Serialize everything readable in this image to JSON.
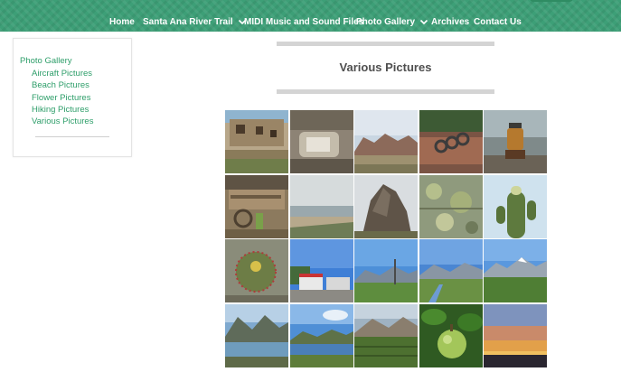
{
  "nav": {
    "items": [
      {
        "label": "Home",
        "dropdown": false
      },
      {
        "label": "Santa Ana River Trail",
        "dropdown": true
      },
      {
        "label": "MIDI Music and Sound Files",
        "dropdown": false
      },
      {
        "label": "Photo Gallery",
        "dropdown": true
      },
      {
        "label": "Archives",
        "dropdown": false
      },
      {
        "label": "Contact Us",
        "dropdown": false
      }
    ]
  },
  "sidebar": {
    "heading": "Photo Gallery",
    "links": [
      "Aircraft Pictures",
      "Beach Pictures",
      "Flower Pictures",
      "Hiking Pictures",
      "Various Pictures"
    ]
  },
  "page": {
    "title": "Various Pictures"
  },
  "colors": {
    "header_green": "#3d9f77",
    "link_green": "#2e9e6a",
    "title_gray": "#4f4f4f"
  },
  "gallery": {
    "thumbnails": [
      {
        "name": "cliff-dwelling-photo"
      },
      {
        "name": "ruin-doorway-photo"
      },
      {
        "name": "rock-formation-photo"
      },
      {
        "name": "chain-on-log-photo"
      },
      {
        "name": "lantern-photo"
      },
      {
        "name": "old-wagon-photo"
      },
      {
        "name": "foggy-beach-photo"
      },
      {
        "name": "rock-spire-photo"
      },
      {
        "name": "lichen-rock-photo"
      },
      {
        "name": "saguaro-cactus-photo"
      },
      {
        "name": "barrel-cactus-photo"
      },
      {
        "name": "gas-station-photo"
      },
      {
        "name": "mountain-meadow-photo"
      },
      {
        "name": "mountain-creek-photo"
      },
      {
        "name": "snowy-mountain-meadow-photo"
      },
      {
        "name": "mountain-lake-photo"
      },
      {
        "name": "lakeside-camp-photo"
      },
      {
        "name": "valley-orchard-photo"
      },
      {
        "name": "green-fruit-photo"
      },
      {
        "name": "sunset-sky-photo"
      }
    ]
  }
}
